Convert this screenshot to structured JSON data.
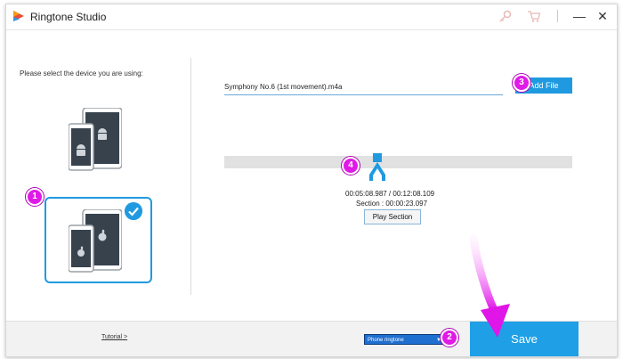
{
  "titlebar": {
    "title": "Ringtone Studio",
    "icons": [
      "app-logo-icon",
      "key-icon",
      "cart-icon",
      "minimize-icon",
      "close-icon"
    ],
    "minimize_glyph": "—",
    "close_glyph": "✕"
  },
  "device_panel": {
    "prompt": "Please select the device you are using:",
    "devices": [
      "android",
      "ios"
    ],
    "selected": "ios"
  },
  "file": {
    "value": "Symphony No.6 (1st movement).m4a",
    "add_label": "Add File"
  },
  "trimmer": {
    "time": "00:05:08.987 / 00:12:08.109",
    "section": "Section : 00:00:23.097",
    "play_label": "Play Section",
    "position": 0.42
  },
  "bottom": {
    "tutorial": "Tutorial >",
    "ringtone_type": "Phone ringtone",
    "save_label": "Save"
  },
  "callouts": [
    "1",
    "2",
    "3",
    "4"
  ],
  "colors": {
    "accent": "#1f9ae0",
    "callout": "#e01ae6",
    "save": "#1fa0e6"
  }
}
